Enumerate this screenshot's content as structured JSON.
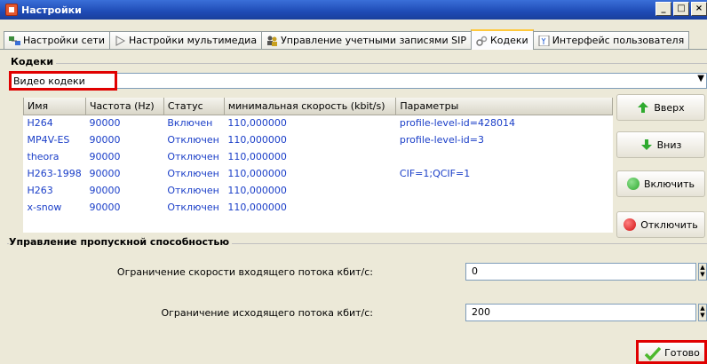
{
  "window": {
    "title": "Настройки",
    "controls": [
      "_",
      "□",
      "×"
    ]
  },
  "tabs": [
    {
      "label": "Настройки сети",
      "icon": "network-icon"
    },
    {
      "label": "Настройки мультимедиа",
      "icon": "play-triangle-icon"
    },
    {
      "label": "Управление учетными записями SIP",
      "icon": "users-icon"
    },
    {
      "label": "Кодеки",
      "icon": "gears-icon",
      "active": true
    },
    {
      "label": "Интерфейс пользователя",
      "icon": "user-interface-icon"
    }
  ],
  "codecs_group": {
    "title": "Кодеки"
  },
  "codec_type": {
    "selected": "Видео кодеки",
    "arrow": "▼"
  },
  "table": {
    "columns": [
      "Имя",
      "Частота (Hz)",
      "Статус",
      "минимальная скорость (kbit/s)",
      "Параметры"
    ],
    "rows": [
      [
        "H264",
        "90000",
        "Включен",
        "110,000000",
        "profile-level-id=428014"
      ],
      [
        "MP4V-ES",
        "90000",
        "Отключен",
        "110,000000",
        "profile-level-id=3"
      ],
      [
        "theora",
        "90000",
        "Отключен",
        "110,000000",
        ""
      ],
      [
        "H263-1998",
        "90000",
        "Отключен",
        "110,000000",
        "CIF=1;QCIF=1"
      ],
      [
        "H263",
        "90000",
        "Отключен",
        "110,000000",
        ""
      ],
      [
        "x-snow",
        "90000",
        "Отключен",
        "110,000000",
        ""
      ]
    ]
  },
  "side_buttons": {
    "up": "Вверх",
    "down": "Вниз",
    "enable": "Включить",
    "disable": "Отключить"
  },
  "bandwidth_group": {
    "title": "Управление пропускной способностью",
    "incoming_label": "Ограничение скорости входящего потока кбит/с:",
    "incoming_value": "0",
    "outgoing_label": "Ограничение исходящего потока кбит/с:",
    "outgoing_value": "200"
  },
  "done_button": "Готово",
  "colors": {
    "accent_blue": "#1a3ec8",
    "highlight_red": "#e00000",
    "enable_green": "#2faa2f",
    "disable_red": "#d01010"
  }
}
